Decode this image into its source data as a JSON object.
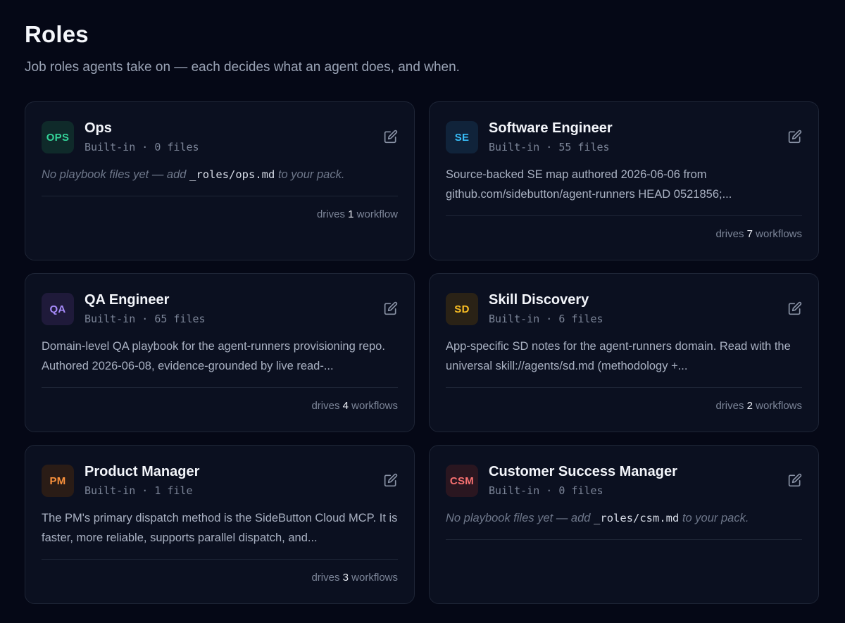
{
  "header": {
    "title": "Roles",
    "subtitle": "Job roles agents take on — each decides what an agent does, and when."
  },
  "roles": [
    {
      "badge": "OPS",
      "badge_color": "#34d399",
      "badge_bg": "#0f2a2a",
      "name": "Ops",
      "meta": "Built-in · 0 files",
      "empty_prefix": "No playbook files yet — add ",
      "empty_path": "_roles/ops.md",
      "empty_suffix": " to your pack.",
      "drives_prefix": "drives ",
      "drives_count": "1",
      "drives_suffix": " workflow"
    },
    {
      "badge": "SE",
      "badge_color": "#38bdf8",
      "badge_bg": "#10233a",
      "name": "Software Engineer",
      "meta": "Built-in · 55 files",
      "description": "Source-backed SE map authored 2026-06-06 from github.com/sidebutton/agent-runners HEAD 0521856;...",
      "drives_prefix": "drives ",
      "drives_count": "7",
      "drives_suffix": " workflows"
    },
    {
      "badge": "QA",
      "badge_color": "#a78bfa",
      "badge_bg": "#1f1a3a",
      "name": "QA Engineer",
      "meta": "Built-in · 65 files",
      "description": "Domain-level QA playbook for the agent-runners provisioning repo. Authored 2026-06-08, evidence-grounded by live read-...",
      "drives_prefix": "drives ",
      "drives_count": "4",
      "drives_suffix": " workflows"
    },
    {
      "badge": "SD",
      "badge_color": "#fbbf24",
      "badge_bg": "#2a2216",
      "name": "Skill Discovery",
      "meta": "Built-in · 6 files",
      "description": "App-specific SD notes for the agent-runners domain. Read with the universal skill://agents/sd.md (methodology +...",
      "drives_prefix": "drives ",
      "drives_count": "2",
      "drives_suffix": " workflows"
    },
    {
      "badge": "PM",
      "badge_color": "#fb923c",
      "badge_bg": "#2a1c16",
      "name": "Product Manager",
      "meta": "Built-in · 1 file",
      "description": "The PM's primary dispatch method is the SideButton Cloud MCP. It is faster, more reliable, supports parallel dispatch, and...",
      "drives_prefix": "drives ",
      "drives_count": "3",
      "drives_suffix": " workflows"
    },
    {
      "badge": "CSM",
      "badge_color": "#f87171",
      "badge_bg": "#2a1620",
      "name": "Customer Success Manager",
      "meta": "Built-in · 0 files",
      "empty_prefix": "No playbook files yet — add ",
      "empty_path": "_roles/csm.md",
      "empty_suffix": " to your pack."
    }
  ]
}
